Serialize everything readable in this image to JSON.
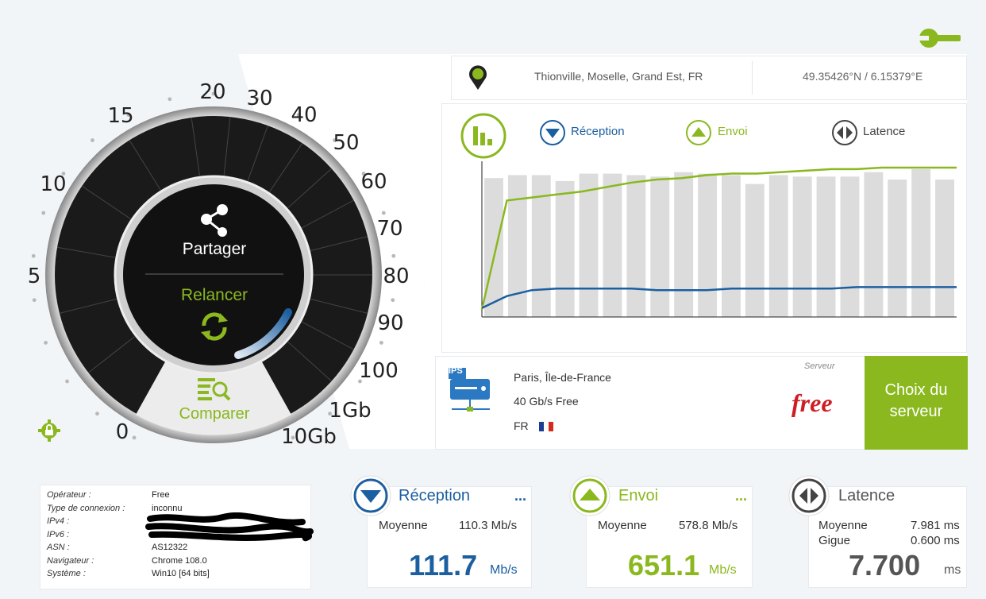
{
  "location": {
    "city": "Thionville, Moselle, Grand Est, FR",
    "coords": "49.35426°N / 6.15379°E"
  },
  "dial": {
    "ticks": [
      "0",
      "5",
      "10",
      "15",
      "20",
      "30",
      "40",
      "50",
      "60",
      "70",
      "80",
      "90",
      "100",
      "1Gb",
      "10Gb"
    ],
    "share_label": "Partager",
    "rerun_label": "Relancer",
    "compare_label": "Comparer"
  },
  "legend": {
    "download": "Réception",
    "upload": "Envoi",
    "latency": "Latence"
  },
  "chart_data": {
    "type": "bar",
    "bars": [
      0.94,
      0.96,
      0.96,
      0.92,
      0.97,
      0.97,
      0.96,
      0.95,
      0.98,
      0.97,
      0.96,
      0.9,
      0.96,
      0.95,
      0.95,
      0.95,
      0.98,
      0.93,
      1.0,
      0.93
    ],
    "series": [
      {
        "name": "Envoi",
        "color": "#8ab81e",
        "values": [
          0.05,
          0.78,
          0.8,
          0.82,
          0.84,
          0.87,
          0.9,
          0.92,
          0.93,
          0.95,
          0.96,
          0.96,
          0.97,
          0.98,
          0.99,
          0.99,
          1.0,
          1.0,
          1.0,
          1.0
        ]
      },
      {
        "name": "Réception",
        "color": "#1c5fa0",
        "values": [
          0.06,
          0.14,
          0.18,
          0.19,
          0.19,
          0.19,
          0.19,
          0.18,
          0.18,
          0.18,
          0.19,
          0.19,
          0.19,
          0.19,
          0.19,
          0.2,
          0.2,
          0.2,
          0.2,
          0.2
        ]
      }
    ]
  },
  "server": {
    "badge": "IPS",
    "city": "Paris, Île-de-France",
    "link": "40 Gb/s Free",
    "country": "FR",
    "section_label": "Serveur",
    "provider": "free",
    "choose_label": "Choix du serveur"
  },
  "info": {
    "rows": [
      {
        "label": "Opérateur :",
        "value": "Free"
      },
      {
        "label": "Type de connexion :",
        "value": "inconnu"
      },
      {
        "label": "IPv4 :",
        "value": ""
      },
      {
        "label": "IPv6 :",
        "value": ""
      },
      {
        "label": "ASN :",
        "value": "AS12322"
      },
      {
        "label": "Navigateur :",
        "value": "Chrome 108.0"
      },
      {
        "label": "Système :",
        "value": "Win10 [64 bits]"
      }
    ]
  },
  "download_card": {
    "title": "Réception",
    "more": "...",
    "avg_label": "Moyenne",
    "avg_value": "110.3 Mb/s",
    "value": "111.7",
    "unit": "Mb/s"
  },
  "upload_card": {
    "title": "Envoi",
    "more": "...",
    "avg_label": "Moyenne",
    "avg_value": "578.8 Mb/s",
    "value": "651.1",
    "unit": "Mb/s"
  },
  "latency_card": {
    "title": "Latence",
    "avg_label": "Moyenne",
    "avg_value": "7.981 ms",
    "jitter_label": "Gigue",
    "jitter_value": "0.600 ms",
    "value": "7.700",
    "unit": "ms"
  },
  "colors": {
    "accent_green": "#8ab81e",
    "accent_blue": "#1c5fa0",
    "free_red": "#cd1e25"
  }
}
